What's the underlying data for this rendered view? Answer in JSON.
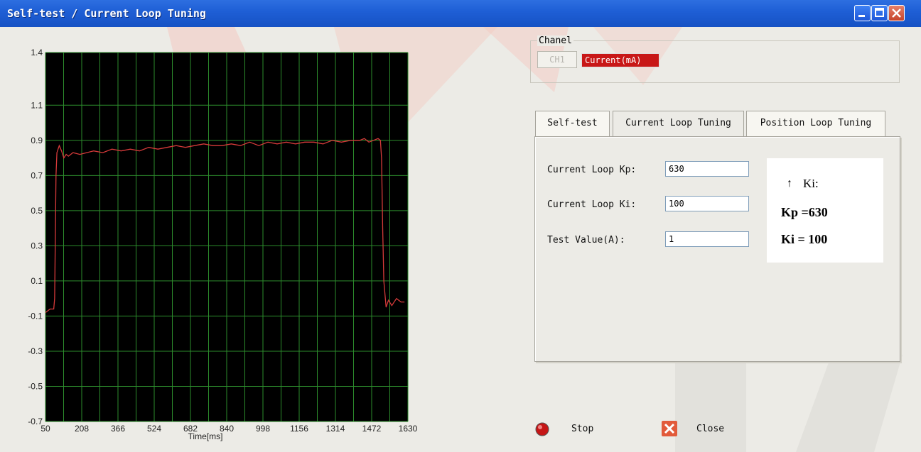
{
  "window": {
    "title": "Self-test / Current Loop Tuning"
  },
  "chart_data": {
    "type": "line",
    "xlabel": "Time[ms]",
    "ylabel": "",
    "x_ticks": [
      50,
      208,
      366,
      524,
      682,
      840,
      998,
      1156,
      1314,
      1472,
      1630
    ],
    "y_ticks": [
      1.4,
      1.1,
      0.9,
      0.7,
      0.5,
      0.3,
      0.1,
      -0.1,
      -0.3,
      -0.5,
      -0.7
    ],
    "ylim": [
      -0.7,
      1.4
    ],
    "xlim": [
      50,
      1630
    ],
    "grid": true,
    "background": "#000000",
    "grid_color": "#2c8c2c",
    "line_color": "#d63a3a",
    "series": [
      {
        "x": [
          50,
          60,
          70,
          80,
          86,
          90,
          96,
          100,
          110,
          120,
          130,
          140,
          150,
          170,
          200,
          230,
          260,
          300,
          340,
          380,
          420,
          460,
          500,
          540,
          580,
          620,
          660,
          700,
          740,
          780,
          820,
          860,
          900,
          940,
          980,
          1020,
          1060,
          1100,
          1140,
          1180,
          1220,
          1260,
          1300,
          1340,
          1380,
          1420,
          1440,
          1460,
          1480,
          1500,
          1510,
          1515,
          1520,
          1525,
          1535,
          1545,
          1560,
          1580,
          1600,
          1615
        ],
        "values": [
          -0.08,
          -0.07,
          -0.06,
          -0.06,
          -0.06,
          0.0,
          0.7,
          0.83,
          0.87,
          0.84,
          0.8,
          0.82,
          0.81,
          0.83,
          0.82,
          0.83,
          0.84,
          0.83,
          0.85,
          0.84,
          0.85,
          0.84,
          0.86,
          0.85,
          0.86,
          0.87,
          0.86,
          0.87,
          0.88,
          0.87,
          0.87,
          0.88,
          0.87,
          0.89,
          0.87,
          0.89,
          0.88,
          0.89,
          0.88,
          0.89,
          0.89,
          0.88,
          0.9,
          0.89,
          0.9,
          0.9,
          0.91,
          0.89,
          0.9,
          0.91,
          0.9,
          0.8,
          0.4,
          0.1,
          -0.05,
          -0.01,
          -0.04,
          0.0,
          -0.02,
          -0.02
        ]
      }
    ]
  },
  "channel": {
    "legend": "Chanel",
    "ch_button": "CH1",
    "current_label": "Current(mA)"
  },
  "tabs": [
    {
      "label": "Self-test"
    },
    {
      "label": "Current Loop Tuning"
    },
    {
      "label": "Position Loop Tuning"
    }
  ],
  "form": {
    "kp_label": "Current Loop Kp:",
    "kp_value": "630",
    "ki_label": "Current Loop Ki:",
    "ki_value": "100",
    "test_label": "Test Value(A):",
    "test_value": "1"
  },
  "note": {
    "arrow": "↑",
    "ki_text": "Ki:",
    "kp_line": "Kp =630",
    "ki_line": "Ki = 100"
  },
  "buttons": {
    "stop": "Stop",
    "close": "Close"
  }
}
